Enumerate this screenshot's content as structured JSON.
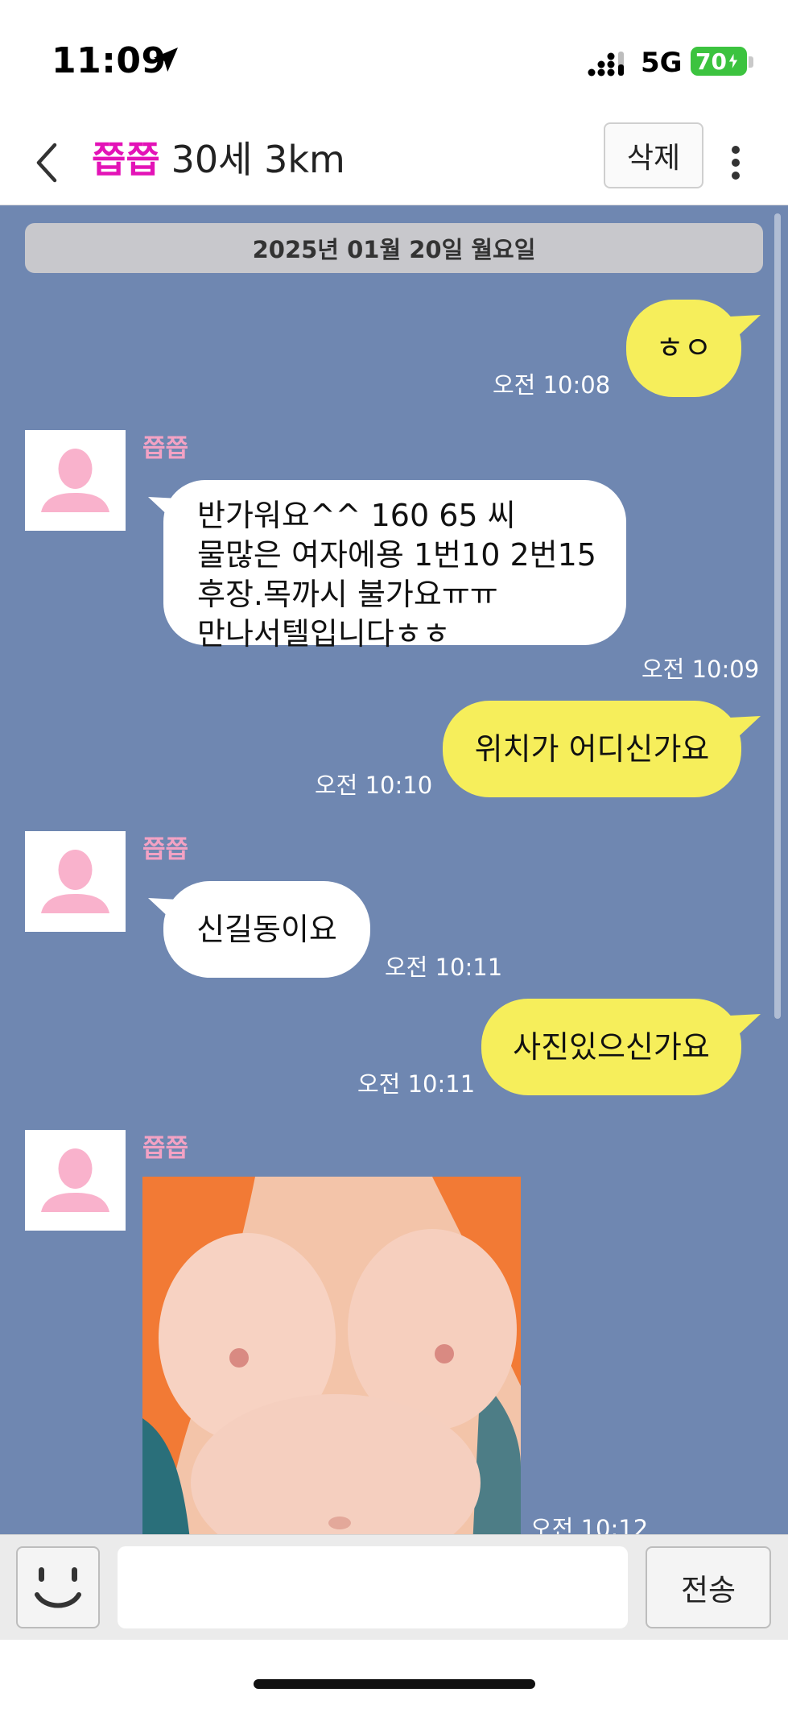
{
  "status_bar": {
    "time": "11:09",
    "network": "5G",
    "battery": "70"
  },
  "header": {
    "nickname": "쯥쯥",
    "info": "30세 3km",
    "delete_label": "삭제"
  },
  "chat": {
    "date_divider": "2025년 01월 20일 월요일",
    "sender_name": "쯥쯥",
    "messages": [
      {
        "from": "me",
        "text": "ㅎㅇ",
        "time": "오전 10:08"
      },
      {
        "from": "them",
        "lines": [
          "반가워요^^  160 65 씨",
          "물많은 여자에용 1번10 2번15",
          "후장.목까시 불가요ㅠㅠ",
          "만나서텔입니다ㅎㅎ"
        ],
        "time": "오전 10:09"
      },
      {
        "from": "me",
        "text": "위치가 어디신가요",
        "time": "오전 10:10"
      },
      {
        "from": "them",
        "text": "신길동이요",
        "time": "오전 10:11"
      },
      {
        "from": "me",
        "text": "사진있으신가요",
        "time": "오전 10:11"
      },
      {
        "from": "them",
        "type": "photo",
        "time": "오전 10:12"
      }
    ]
  },
  "input_bar": {
    "placeholder": "",
    "send_label": "전송"
  },
  "icons": [
    "location-arrow-icon",
    "signal-icon",
    "battery-icon",
    "back-chevron-icon",
    "more-vertical-icon",
    "avatar-person-icon",
    "emoji-icon"
  ],
  "colors": {
    "chat_bg": "#6f87b1",
    "my_bubble": "#f6ee5b",
    "their_bubble": "#ffffff",
    "nickname": "#e313b7",
    "sender_name": "#f3a2c4",
    "battery": "#3cc33f"
  }
}
